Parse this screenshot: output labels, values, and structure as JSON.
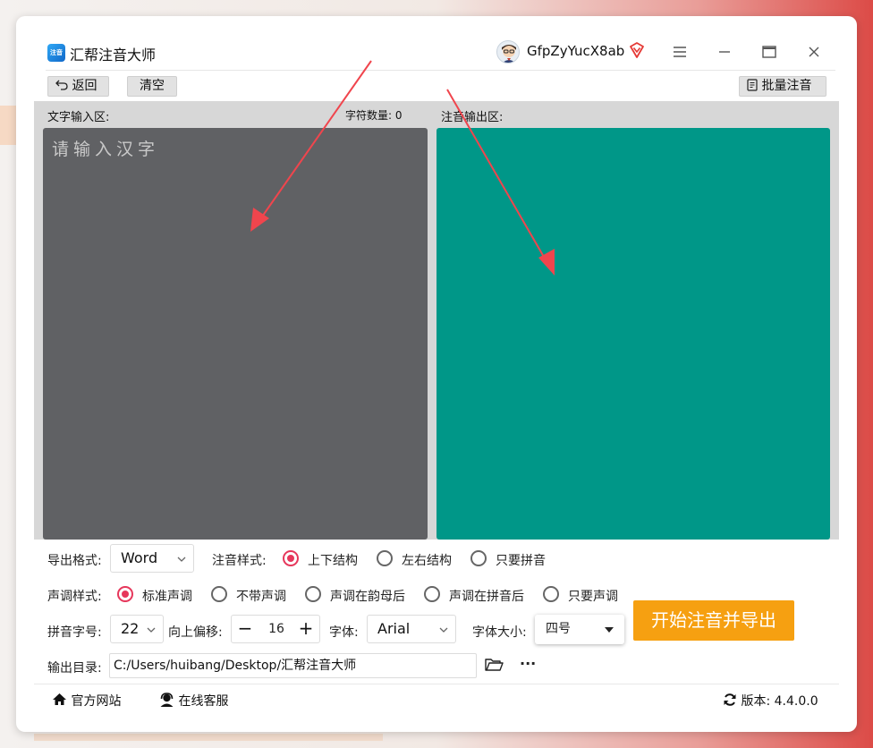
{
  "app": {
    "title": "汇帮注音大师",
    "logo_text": "注音"
  },
  "user": {
    "name": "GfpZyYucX8ab"
  },
  "toolbar": {
    "back_label": "返回",
    "clear_label": "清空",
    "batch_label": "批量注音"
  },
  "input": {
    "label": "文字输入区:",
    "char_count_label": "字符数量: 0",
    "placeholder": "请输入汉字"
  },
  "output": {
    "label": "注音输出区:"
  },
  "settings": {
    "export_format": {
      "label": "导出格式:",
      "value": "Word"
    },
    "annotation_style": {
      "label": "注音样式:",
      "options": [
        "上下结构",
        "左右结构",
        "只要拼音"
      ],
      "selected": 0
    },
    "tone_style": {
      "label": "声调样式:",
      "options": [
        "标准声调",
        "不带声调",
        "声调在韵母后",
        "声调在拼音后",
        "只要声调"
      ],
      "selected": 0
    },
    "pinyin_size": {
      "label": "拼音字号:",
      "value": "22"
    },
    "offset": {
      "label": "向上偏移:",
      "value": "16",
      "minus": "−",
      "plus": "+"
    },
    "font": {
      "label": "字体:",
      "value": "Arial"
    },
    "font_size": {
      "label": "字体大小:",
      "value": "四号"
    },
    "output_dir": {
      "label": "输出目录:",
      "value": "C:/Users/huibang/Desktop/汇帮注音大师"
    },
    "start_label": "开始注音并导出",
    "more_label": "···"
  },
  "footer": {
    "website": "官方网站",
    "support": "在线客服",
    "version": "版本: 4.4.0.0"
  },
  "colors": {
    "input_bg": "#606164",
    "output_bg": "#009788",
    "accent": "#e6375b",
    "start_btn": "#f6a011",
    "arrow": "#f0454d"
  }
}
